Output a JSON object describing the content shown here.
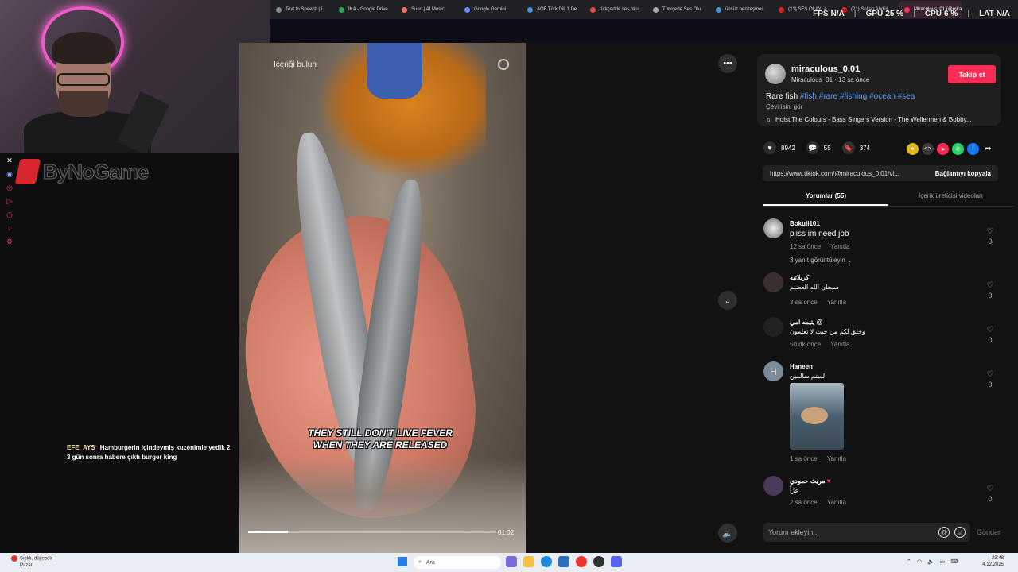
{
  "browser_tabs": [
    {
      "label": "Text to Speech | L",
      "color": "#888888"
    },
    {
      "label": "İKA - Google Drive",
      "color": "#2ea44f"
    },
    {
      "label": "Suno | AI Music",
      "color": "#ff6b6b"
    },
    {
      "label": "Google Gemini",
      "color": "#6b8cff"
    },
    {
      "label": "AÖF Türk Dili 1 De",
      "color": "#4a90d9"
    },
    {
      "label": "türkçedde ses oku",
      "color": "#e04b4b"
    },
    {
      "label": "Türkçede Ses Olu",
      "color": "#aaaaaa"
    },
    {
      "label": "ünsüz benzeşmes",
      "color": "#4a90d9"
    },
    {
      "label": "(21) SES OLAYLA",
      "color": "#e02020"
    },
    {
      "label": "(21) Sultan Abdül",
      "color": "#e02020"
    },
    {
      "label": "Miraculous_01 (@mira",
      "color": "#ff2c55"
    }
  ],
  "overlay_stats": {
    "fps_label": "FPS",
    "fps_value": "N/A",
    "gpu_label": "GPU",
    "gpu_value": "25 %",
    "cpu_label": "CPU",
    "cpu_value": "6 %",
    "lat_label": "LAT",
    "lat_value": "N/A"
  },
  "stream": {
    "logo_text": "ByNoGame",
    "chat_user": "EFE_AYS",
    "chat_message": "Hamburgerin içindeymiş kuzenimle yedik 2 3 gün sonra habere çıktı burger king"
  },
  "video": {
    "search_placeholder": "İçeriği bulun",
    "caption_line1": "THEY STILL DON'T LIVE FEVER",
    "caption_line2": "WHEN THEY ARE RELEASED",
    "time": "01:02",
    "progress_percent": 16
  },
  "creator": {
    "username": "miraculous_0.01",
    "subline": "Miraculous_01 · 13 sa önce",
    "follow_label": "Takip et",
    "description_text": "Rare fish",
    "hashtags": "#fish #rare #fishing #ocean #sea",
    "translate_label": "Çevirisini gör",
    "music": "Hoist The Colours - Bass Singers Version - The Wellermen & Bobby..."
  },
  "stats": {
    "likes": "8942",
    "comments": "55",
    "saves": "374"
  },
  "link": {
    "url": "https://www.tiktok.com/@miraculous_0.01/vi...",
    "copy_label": "Bağlantıyı kopyala"
  },
  "tabs": {
    "comments": "Yorumlar (55)",
    "creator_videos": "İçerik üreticisi videoları"
  },
  "comments": [
    {
      "user": "Bokull101",
      "text": "pliss im need job",
      "time": "12 sa önce",
      "reply": "Yanıtla",
      "likes": "0",
      "more": "3 yanıt görüntüleyin"
    },
    {
      "user": "كريلاتيه",
      "text": "سبحان الله العضيم",
      "time": "3 sa önce",
      "reply": "Yanıtla",
      "likes": "0"
    },
    {
      "user": "يتيمه امي @",
      "text": "وخلق لكم من حيث لا تعلمون",
      "time": "50 dk önce",
      "reply": "Yanıtla",
      "likes": "0"
    },
    {
      "user": "Haneen",
      "avatar_letter": "H",
      "text": "لستم سالمين",
      "time": "1 sa önce",
      "reply": "Yanıtla",
      "likes": "0"
    },
    {
      "user": "مريث حمودي",
      "text": "عزّاً",
      "time": "2 sa önce",
      "reply": "Yanıtla",
      "likes": "0"
    }
  ],
  "composer": {
    "placeholder": "Yorum ekleyin...",
    "send_label": "Gönder"
  },
  "taskbar": {
    "weather_line1": "Sıcklı, düyecek",
    "weather_line2": "Pazar",
    "search_label": "Ara",
    "time": "23:48",
    "date": "4.12.2025"
  }
}
